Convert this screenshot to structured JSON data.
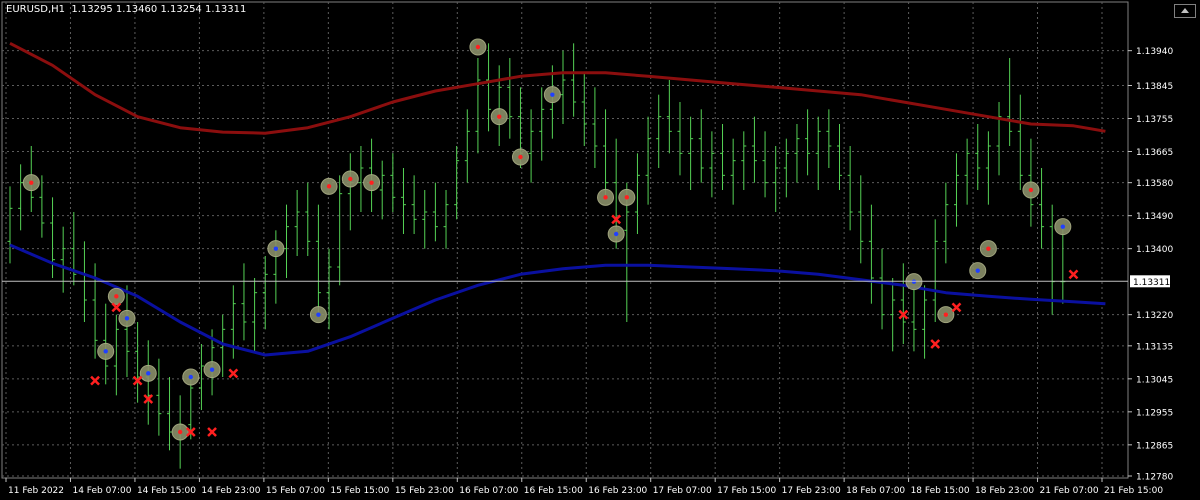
{
  "header": {
    "symbol_timeframe": "EURUSD,H1",
    "ohlc": "1.13295 1.13460 1.13254 1.13311"
  },
  "colors": {
    "background": "#000000",
    "grid": "#5c5c5c",
    "axis_text": "#ffffff",
    "candle": "#55d255",
    "slow_ma": "#8b0e0e",
    "fast_ma": "#0a10a0",
    "marker_sell": "#ff2020",
    "marker_buy": "#2040ff",
    "marker_ring": "#8a8f6a",
    "price_line": "#c0c0c0"
  },
  "chart_data": {
    "type": "line",
    "chart_kind": "price-chart-with-indicators",
    "current_price": "1.13311",
    "y_ticks": [
      "1.13940",
      "1.13845",
      "1.13755",
      "1.13665",
      "1.13580",
      "1.13490",
      "1.13400",
      "1.13311",
      "1.13220",
      "1.13135",
      "1.13045",
      "1.12955",
      "1.12865",
      "1.12780"
    ],
    "y_range": [
      1.1278,
      1.1404
    ],
    "x_ticks": [
      "11 Feb 2022",
      "14 Feb 07:00",
      "14 Feb 15:00",
      "14 Feb 23:00",
      "15 Feb 07:00",
      "15 Feb 15:00",
      "15 Feb 23:00",
      "16 Feb 07:00",
      "16 Feb 15:00",
      "16 Feb 23:00",
      "17 Feb 07:00",
      "17 Feb 15:00",
      "17 Feb 23:00",
      "18 Feb 07:00",
      "18 Feb 15:00",
      "18 Feb 23:00",
      "21 Feb 07:00",
      "21 Feb 15:00"
    ],
    "series": [
      {
        "color": "#8b0e0e",
        "points": [
          [
            0,
            1.1396
          ],
          [
            4,
            1.139
          ],
          [
            8,
            1.1382
          ],
          [
            12,
            1.1376
          ],
          [
            16,
            1.1373
          ],
          [
            20,
            1.13718
          ],
          [
            24,
            1.13715
          ],
          [
            28,
            1.1373
          ],
          [
            32,
            1.1376
          ],
          [
            36,
            1.138
          ],
          [
            40,
            1.1383
          ],
          [
            44,
            1.1385
          ],
          [
            48,
            1.1387
          ],
          [
            52,
            1.1388
          ],
          [
            56,
            1.1388
          ],
          [
            60,
            1.1387
          ],
          [
            64,
            1.1386
          ],
          [
            68,
            1.1385
          ],
          [
            72,
            1.1384
          ],
          [
            76,
            1.1383
          ],
          [
            80,
            1.1382
          ],
          [
            84,
            1.138
          ],
          [
            88,
            1.1378
          ],
          [
            92,
            1.1376
          ],
          [
            96,
            1.1374
          ],
          [
            100,
            1.13735
          ],
          [
            103,
            1.1372
          ]
        ]
      },
      {
        "color": "#0a10a0",
        "points": [
          [
            0,
            1.1341
          ],
          [
            4,
            1.1336
          ],
          [
            8,
            1.1332
          ],
          [
            12,
            1.1327
          ],
          [
            16,
            1.132
          ],
          [
            20,
            1.1314
          ],
          [
            24,
            1.1311
          ],
          [
            28,
            1.1312
          ],
          [
            32,
            1.1316
          ],
          [
            36,
            1.1321
          ],
          [
            40,
            1.1326
          ],
          [
            44,
            1.133
          ],
          [
            48,
            1.1333
          ],
          [
            52,
            1.13345
          ],
          [
            56,
            1.13355
          ],
          [
            60,
            1.13355
          ],
          [
            64,
            1.1335
          ],
          [
            68,
            1.13345
          ],
          [
            72,
            1.1334
          ],
          [
            76,
            1.1333
          ],
          [
            80,
            1.13315
          ],
          [
            84,
            1.133
          ],
          [
            88,
            1.1328
          ],
          [
            92,
            1.1327
          ],
          [
            96,
            1.13262
          ],
          [
            100,
            1.13255
          ],
          [
            103,
            1.1325
          ]
        ]
      }
    ],
    "bars": [
      [
        0,
        1.1342,
        1.1357,
        1.1336,
        1.1351
      ],
      [
        1,
        1.1351,
        1.1363,
        1.1345,
        1.1358
      ],
      [
        2,
        1.1358,
        1.1368,
        1.135,
        1.1354
      ],
      [
        3,
        1.1354,
        1.136,
        1.1343,
        1.1347
      ],
      [
        4,
        1.1347,
        1.1354,
        1.1332,
        1.1337
      ],
      [
        5,
        1.1337,
        1.1346,
        1.1328,
        1.134
      ],
      [
        6,
        1.134,
        1.135,
        1.133,
        1.1333
      ],
      [
        7,
        1.1333,
        1.1342,
        1.132,
        1.1326
      ],
      [
        8,
        1.1326,
        1.1336,
        1.131,
        1.1315
      ],
      [
        9,
        1.1315,
        1.1325,
        1.1303,
        1.1308
      ],
      [
        10,
        1.1308,
        1.1322,
        1.13,
        1.1318
      ],
      [
        11,
        1.1318,
        1.133,
        1.1305,
        1.1312
      ],
      [
        12,
        1.1312,
        1.132,
        1.1298,
        1.1305
      ],
      [
        13,
        1.1305,
        1.1315,
        1.1292,
        1.13
      ],
      [
        14,
        1.13,
        1.131,
        1.1289,
        1.1295
      ],
      [
        15,
        1.1295,
        1.1305,
        1.1285,
        1.129
      ],
      [
        16,
        1.129,
        1.13,
        1.128,
        1.1292
      ],
      [
        17,
        1.1292,
        1.1306,
        1.1288,
        1.1302
      ],
      [
        18,
        1.1302,
        1.1314,
        1.1296,
        1.1308
      ],
      [
        19,
        1.1308,
        1.1318,
        1.13,
        1.1313
      ],
      [
        20,
        1.1313,
        1.1322,
        1.1305,
        1.1318
      ],
      [
        21,
        1.1318,
        1.133,
        1.131,
        1.1325
      ],
      [
        22,
        1.1325,
        1.1336,
        1.1315,
        1.132
      ],
      [
        23,
        1.132,
        1.1332,
        1.1312,
        1.1328
      ],
      [
        24,
        1.1328,
        1.1338,
        1.1318,
        1.1333
      ],
      [
        25,
        1.1333,
        1.1345,
        1.1325,
        1.134
      ],
      [
        26,
        1.134,
        1.1352,
        1.1332,
        1.1346
      ],
      [
        27,
        1.1346,
        1.1356,
        1.1338,
        1.135
      ],
      [
        28,
        1.135,
        1.1358,
        1.1338,
        1.1342
      ],
      [
        29,
        1.1342,
        1.1352,
        1.1322,
        1.1328
      ],
      [
        30,
        1.1328,
        1.134,
        1.1318,
        1.1335
      ],
      [
        31,
        1.1335,
        1.136,
        1.133,
        1.1355
      ],
      [
        32,
        1.1355,
        1.1366,
        1.1345,
        1.1358
      ],
      [
        33,
        1.1358,
        1.1368,
        1.135,
        1.1362
      ],
      [
        34,
        1.1362,
        1.137,
        1.135,
        1.1356
      ],
      [
        35,
        1.1356,
        1.1364,
        1.1348,
        1.136
      ],
      [
        36,
        1.136,
        1.1366,
        1.135,
        1.1354
      ],
      [
        37,
        1.1354,
        1.1362,
        1.1344,
        1.1352
      ],
      [
        38,
        1.1352,
        1.136,
        1.1344,
        1.1348
      ],
      [
        39,
        1.1348,
        1.1356,
        1.134,
        1.135
      ],
      [
        40,
        1.135,
        1.1358,
        1.1342,
        1.1346
      ],
      [
        41,
        1.1346,
        1.1356,
        1.134,
        1.1352
      ],
      [
        42,
        1.1352,
        1.1368,
        1.1348,
        1.1364
      ],
      [
        43,
        1.1364,
        1.1378,
        1.1358,
        1.1372
      ],
      [
        44,
        1.1372,
        1.1392,
        1.1366,
        1.1386
      ],
      [
        45,
        1.1386,
        1.1396,
        1.1372,
        1.1378
      ],
      [
        46,
        1.1378,
        1.139,
        1.1368,
        1.1384
      ],
      [
        47,
        1.1384,
        1.1392,
        1.137,
        1.1376
      ],
      [
        48,
        1.1376,
        1.1384,
        1.1362,
        1.1366
      ],
      [
        49,
        1.1366,
        1.1378,
        1.1358,
        1.1372
      ],
      [
        50,
        1.1372,
        1.1384,
        1.1364,
        1.1378
      ],
      [
        51,
        1.1378,
        1.139,
        1.137,
        1.1382
      ],
      [
        52,
        1.1382,
        1.1394,
        1.1374,
        1.1386
      ],
      [
        53,
        1.1386,
        1.1396,
        1.1376,
        1.138
      ],
      [
        54,
        1.138,
        1.1388,
        1.1368,
        1.1374
      ],
      [
        55,
        1.1374,
        1.1384,
        1.1362,
        1.1368
      ],
      [
        56,
        1.1368,
        1.1378,
        1.1354,
        1.1358
      ],
      [
        57,
        1.1358,
        1.137,
        1.134,
        1.1345
      ],
      [
        58,
        1.1345,
        1.1358,
        1.132,
        1.135
      ],
      [
        59,
        1.135,
        1.1366,
        1.1344,
        1.136
      ],
      [
        60,
        1.136,
        1.1376,
        1.1352,
        1.137
      ],
      [
        61,
        1.137,
        1.1382,
        1.1362,
        1.1376
      ],
      [
        62,
        1.1376,
        1.1386,
        1.1366,
        1.1372
      ],
      [
        63,
        1.1372,
        1.138,
        1.136,
        1.1366
      ],
      [
        64,
        1.1366,
        1.1376,
        1.1356,
        1.137
      ],
      [
        65,
        1.137,
        1.1378,
        1.1358,
        1.1362
      ],
      [
        66,
        1.1362,
        1.1372,
        1.1354,
        1.1366
      ],
      [
        67,
        1.1366,
        1.1374,
        1.1356,
        1.136
      ],
      [
        68,
        1.136,
        1.137,
        1.1352,
        1.1364
      ],
      [
        69,
        1.1364,
        1.1372,
        1.1356,
        1.1368
      ],
      [
        70,
        1.1368,
        1.1376,
        1.1358,
        1.1364
      ],
      [
        71,
        1.1364,
        1.1372,
        1.1354,
        1.1358
      ],
      [
        72,
        1.1358,
        1.1368,
        1.135,
        1.1362
      ],
      [
        73,
        1.1362,
        1.137,
        1.1354,
        1.1366
      ],
      [
        74,
        1.1366,
        1.1374,
        1.1358,
        1.137
      ],
      [
        75,
        1.137,
        1.1378,
        1.136,
        1.1366
      ],
      [
        76,
        1.1366,
        1.1376,
        1.1356,
        1.1372
      ],
      [
        77,
        1.1372,
        1.1378,
        1.1362,
        1.1368
      ],
      [
        78,
        1.1368,
        1.1374,
        1.1356,
        1.136
      ],
      [
        79,
        1.136,
        1.1368,
        1.1345,
        1.135
      ],
      [
        80,
        1.135,
        1.136,
        1.1336,
        1.1342
      ],
      [
        81,
        1.1342,
        1.1352,
        1.1325,
        1.1332
      ],
      [
        82,
        1.1332,
        1.134,
        1.1318,
        1.1322
      ],
      [
        83,
        1.1322,
        1.1332,
        1.1312,
        1.1326
      ],
      [
        84,
        1.1326,
        1.1336,
        1.1314,
        1.132
      ],
      [
        85,
        1.132,
        1.133,
        1.1312,
        1.1318
      ],
      [
        86,
        1.1318,
        1.133,
        1.131,
        1.1326
      ],
      [
        87,
        1.1326,
        1.1348,
        1.132,
        1.1342
      ],
      [
        88,
        1.1342,
        1.1358,
        1.1336,
        1.1352
      ],
      [
        89,
        1.1352,
        1.1366,
        1.1346,
        1.136
      ],
      [
        90,
        1.136,
        1.137,
        1.1352,
        1.1366
      ],
      [
        91,
        1.1366,
        1.1374,
        1.1356,
        1.1362
      ],
      [
        92,
        1.1362,
        1.1372,
        1.1352,
        1.1368
      ],
      [
        93,
        1.1368,
        1.138,
        1.136,
        1.1376
      ],
      [
        94,
        1.1376,
        1.1392,
        1.1368,
        1.1372
      ],
      [
        95,
        1.1372,
        1.1382,
        1.1356,
        1.136
      ],
      [
        96,
        1.136,
        1.137,
        1.1346,
        1.1352
      ],
      [
        97,
        1.1352,
        1.1362,
        1.134,
        1.1346
      ],
      [
        98,
        1.1346,
        1.1352,
        1.1322,
        1.1331
      ],
      [
        99,
        1.1331,
        1.1346,
        1.1325,
        1.1331
      ]
    ],
    "markers_buy": [
      [
        2,
        1.1358
      ],
      [
        9,
        1.1312
      ],
      [
        10,
        1.1327
      ],
      [
        11,
        1.1321
      ],
      [
        13,
        1.1306
      ],
      [
        16,
        1.129
      ],
      [
        17,
        1.1305
      ],
      [
        19,
        1.1307
      ],
      [
        25,
        1.134
      ],
      [
        29,
        1.1322
      ],
      [
        30,
        1.1357
      ],
      [
        32,
        1.1359
      ],
      [
        34,
        1.1358
      ],
      [
        44,
        1.1395
      ],
      [
        46,
        1.1376
      ],
      [
        48,
        1.1365
      ],
      [
        51,
        1.1382
      ],
      [
        56,
        1.1354
      ],
      [
        57,
        1.1344
      ],
      [
        58,
        1.1354
      ],
      [
        85,
        1.1331
      ],
      [
        88,
        1.1322
      ],
      [
        91,
        1.1334
      ],
      [
        92,
        1.134
      ],
      [
        96,
        1.1356
      ],
      [
        99,
        1.1346
      ]
    ],
    "markers_sell": [
      [
        8,
        1.1304
      ],
      [
        10,
        1.1324
      ],
      [
        12,
        1.1304
      ],
      [
        13,
        1.1299
      ],
      [
        17,
        1.129
      ],
      [
        19,
        1.129
      ],
      [
        21,
        1.1306
      ],
      [
        57,
        1.1348
      ],
      [
        84,
        1.1322
      ],
      [
        87,
        1.1314
      ],
      [
        89,
        1.1324
      ],
      [
        100,
        1.1333
      ]
    ]
  }
}
